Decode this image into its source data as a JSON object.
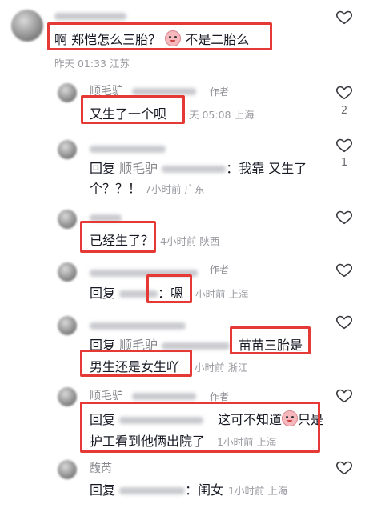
{
  "comments": [
    {
      "text": "啊 郑恺怎么三胎？",
      "text2": "不是二胎么",
      "meta": "昨天 01:33 江苏"
    },
    {
      "user": "顺毛驴",
      "tag": "作者",
      "text": "又生了一个呗",
      "meta": "天 05:08 上海",
      "likes": "2"
    },
    {
      "reply": "回复",
      "to": "顺毛驴",
      "colon": "：我靠 又生了",
      "line2": "个？？！",
      "meta": "7小时前 广东",
      "likes": "1"
    },
    {
      "text": "已经生了？",
      "meta": "4小时前 陕西"
    },
    {
      "tag": "作者",
      "reply": "回复",
      "text": "：嗯",
      "meta": "小时前 上海"
    },
    {
      "reply": "回复",
      "to": "顺毛驴",
      "text": "苗苗三胎是",
      "line2": "男生还是女生吖",
      "meta": "小时前 浙江"
    },
    {
      "user": "顺毛驴",
      "tag": "作者",
      "reply": "回复",
      "text": "这可不知道",
      "text2": "只是",
      "line2": "护工看到他俩出院了",
      "meta": "1小时前 上海"
    },
    {
      "user": "馥芮",
      "reply": "回复",
      "text": "：闺女",
      "meta": "1小时前 上海"
    }
  ]
}
